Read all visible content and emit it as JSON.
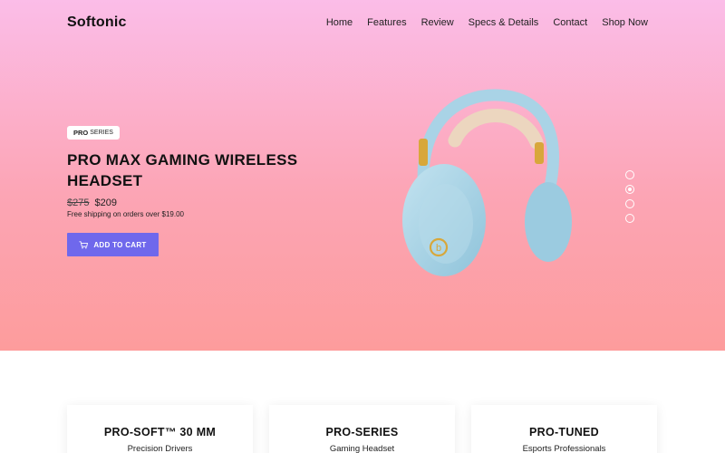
{
  "brand": "Softonic",
  "nav": [
    "Home",
    "Features",
    "Review",
    "Specs & Details",
    "Contact",
    "Shop Now"
  ],
  "hero": {
    "badge_strong": "PRO",
    "badge_rest": "SERIES",
    "title": "PRO MAX GAMING WIRELESS HEADSET",
    "old_price": "$275",
    "price": "$209",
    "shipping": "Free shipping on orders over $19.00",
    "cta_label": "ADD TO CART",
    "cta_icon": "cart-icon",
    "slider_dots": 4,
    "active_dot": 2
  },
  "features": [
    {
      "title": "PRO-SOFT™ 30 MM",
      "subtitle": "Precision Drivers"
    },
    {
      "title": "PRO-SERIES",
      "subtitle": "Gaming Headset"
    },
    {
      "title": "PRO-TUNED",
      "subtitle": "Esports Professionals"
    }
  ],
  "colors": {
    "hero_top": "#fbbde8",
    "hero_bottom": "#fd9c9c",
    "button": "#6f68ec",
    "headphone_cup": "#a9d3e6",
    "headphone_band": "#ecd6bf",
    "headphone_accent": "#d8a73a"
  }
}
